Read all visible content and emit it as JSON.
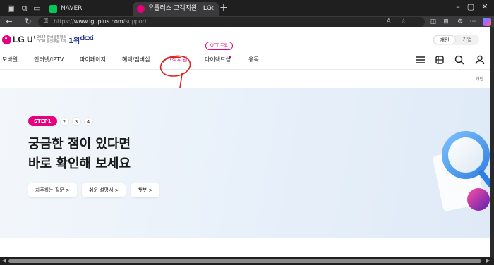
{
  "browser": {
    "tabs": [
      {
        "title": "NAVER",
        "favicon_color": "#03c75a",
        "active": false
      },
      {
        "title": "유플러스 고객지원 | LG U+",
        "favicon_color": "#e6007e",
        "active": true
      }
    ],
    "url_prefix": "https://",
    "url_domain": "www.lguplus.com",
    "url_path": "/support"
  },
  "header": {
    "logo_text": "LG U",
    "logo_sup": "+",
    "award_line1": "2024 한국품질협회",
    "award_line2": "DCXI 통신부문 1위",
    "award_rank": "1위",
    "award_brand": "dcxi",
    "segment": [
      {
        "label": "개인",
        "selected": true
      },
      {
        "label": "기업",
        "selected": false
      }
    ]
  },
  "gnb": {
    "items": [
      {
        "label": "모바일",
        "active": false
      },
      {
        "label": "인터넷/IPTV",
        "active": false
      },
      {
        "label": "마이페이지",
        "active": false
      },
      {
        "label": "혜택/멤버십",
        "active": false
      },
      {
        "label": "고객지원",
        "active": true
      },
      {
        "label": "다이렉트샵",
        "active": false
      },
      {
        "label": "유독",
        "active": false
      }
    ],
    "ott_badge": "OTT 무료",
    "icons": [
      "menu-icon",
      "store-icon",
      "search-icon",
      "user-icon"
    ]
  },
  "sub_label": "개인",
  "hero": {
    "step_active": "STEP1",
    "steps": [
      "2",
      "3",
      "4"
    ],
    "title_line1": "궁금한 점이 있다면",
    "title_line2": "바로 확인해 보세요",
    "buttons": [
      "자주하는 질문 >",
      "쉬운 설명서 >",
      "챗봇 >"
    ]
  },
  "colors": {
    "brand": "#e6007e",
    "annotation": "#d7261e"
  }
}
